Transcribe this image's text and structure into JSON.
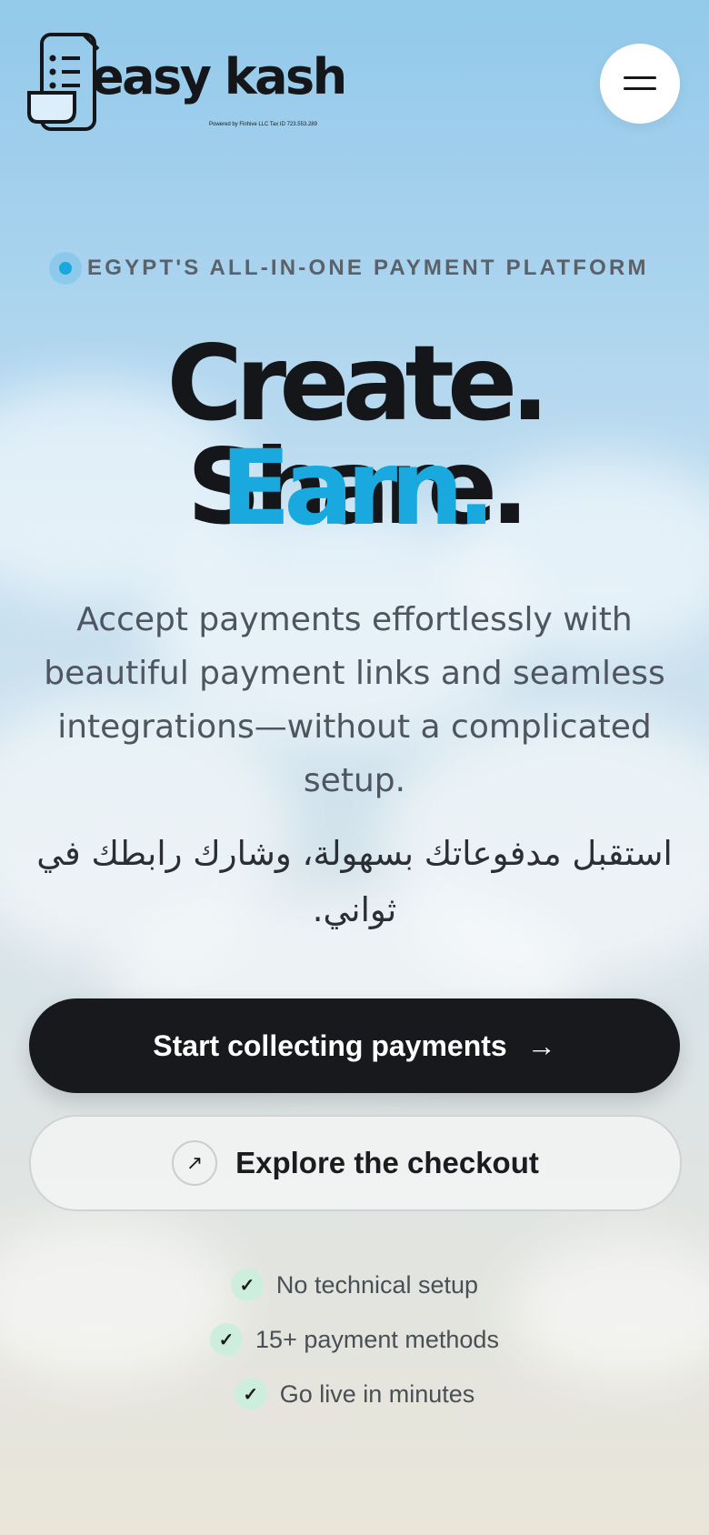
{
  "brand": {
    "name": "easy kash",
    "tagline": "Powered by Finhive LLC Tax ID 723.553.289"
  },
  "header": {
    "menu_icon": "hamburger-menu-icon"
  },
  "badge": {
    "text": "EGYPT'S ALL-IN-ONE PAYMENT PLATFORM"
  },
  "hero": {
    "line1": "Create. Share.",
    "line2": "Earn.",
    "description": "Accept payments effortlessly with beautiful payment links and seamless integrations—without a complicated setup.",
    "arabic": "استقبل مدفوعاتك بسهولة، وشارك رابطك في ثواني."
  },
  "cta": {
    "primary_label": "Start collecting payments",
    "primary_icon": "arrow-right-icon",
    "secondary_label": "Explore the checkout",
    "secondary_icon": "arrow-up-right-icon"
  },
  "features": [
    {
      "label": "No technical setup",
      "icon": "check-icon"
    },
    {
      "label": "15+ payment methods",
      "icon": "check-icon"
    },
    {
      "label": "Go live in minutes",
      "icon": "check-icon"
    }
  ],
  "colors": {
    "accent": "#19a9df",
    "dark": "#15161a",
    "check_bg": "#cdeedd"
  }
}
